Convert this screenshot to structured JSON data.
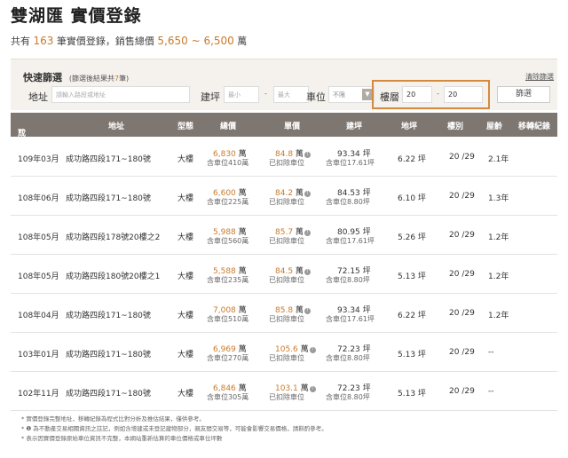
{
  "header": {
    "title": "雙湖匯 實價登錄",
    "summary_prefix": "共有",
    "count": "163",
    "summary_mid": "筆實價登錄，銷售總價",
    "price_range": "5,650 ~ 6,500",
    "summary_suffix": "萬"
  },
  "filter": {
    "title": "快速篩選",
    "subtitle_prefix": "(篩選後結果共",
    "result_count": "7",
    "subtitle_suffix": "筆)",
    "clear_label": "清除篩選",
    "address_label": "地址",
    "address_placeholder": "請輸入路段或地址",
    "area_label": "建坪",
    "area_min_placeholder": "最小",
    "area_max_placeholder": "最大",
    "parking_label": "車位",
    "parking_value": "不限",
    "floor_label": "樓層",
    "floor_min": "20",
    "floor_max": "20",
    "dash": "-",
    "search_label": "篩選"
  },
  "table": {
    "headers": [
      "成交年月",
      "地址",
      "型態",
      "總價",
      "單價",
      "建坪",
      "地坪",
      "樓別",
      "屋齡",
      "移轉紀錄"
    ],
    "sort_arrow": "▾",
    "wan": "萬",
    "ping": "坪",
    "info_glyph": "!",
    "rows": [
      {
        "date": "109年03月",
        "address": "成功路四段171~180號",
        "type": "大樓",
        "total": "6,830",
        "total_sub": "含車位410萬",
        "unit": "84.8",
        "unit_sub": "已扣除車位",
        "area": "93.34",
        "area_sub": "含車位17.61坪",
        "land": "6.22",
        "floor": "20 /29",
        "age": "2.1年"
      },
      {
        "date": "108年06月",
        "address": "成功路四段171~180號",
        "type": "大樓",
        "total": "6,600",
        "total_sub": "含車位225萬",
        "unit": "84.2",
        "unit_sub": "已扣除車位",
        "area": "84.53",
        "area_sub": "含車位8.80坪",
        "land": "6.10",
        "floor": "20 /29",
        "age": "1.3年"
      },
      {
        "date": "108年05月",
        "address": "成功路四段178號20樓之2",
        "type": "大樓",
        "total": "5,988",
        "total_sub": "含車位560萬",
        "unit": "85.7",
        "unit_sub": "已扣除車位",
        "area": "80.95",
        "area_sub": "含車位17.61坪",
        "land": "5.26",
        "floor": "20 /29",
        "age": "1.2年"
      },
      {
        "date": "108年05月",
        "address": "成功路四段180號20樓之1",
        "type": "大樓",
        "total": "5,588",
        "total_sub": "含車位235萬",
        "unit": "84.5",
        "unit_sub": "已扣除車位",
        "area": "72.15",
        "area_sub": "含車位8.80坪",
        "land": "5.13",
        "floor": "20 /29",
        "age": "1.2年"
      },
      {
        "date": "108年04月",
        "address": "成功路四段171~180號",
        "type": "大樓",
        "total": "7,008",
        "total_sub": "含車位510萬",
        "unit": "85.8",
        "unit_sub": "已扣除車位",
        "area": "93.34",
        "area_sub": "含車位17.61坪",
        "land": "6.22",
        "floor": "20 /29",
        "age": "1.2年"
      },
      {
        "date": "103年01月",
        "address": "成功路四段171~180號",
        "type": "大樓",
        "total": "6,969",
        "total_sub": "含車位270萬",
        "unit": "105.6",
        "unit_sub": "已扣除車位",
        "area": "72.23",
        "area_sub": "含車位8.80坪",
        "land": "5.13",
        "floor": "20 /29",
        "age": "--"
      },
      {
        "date": "102年11月",
        "address": "成功路四段171~180號",
        "type": "大樓",
        "total": "6,846",
        "total_sub": "含車位305萬",
        "unit": "103.1",
        "unit_sub": "已扣除車位",
        "area": "72.23",
        "area_sub": "含車位8.80坪",
        "land": "5.13",
        "floor": "20 /29",
        "age": "--"
      }
    ]
  },
  "notes": [
    "* 實價登錄完整地址，移轉紀錄為程式比對分析及推估結果，僅供參考。",
    "* ❶ 為不動產交易相關資訊之註記，例如含增建或未登記建物部分，親友間交易等，可能會影響交易價格，請斟酌參考。",
    "* 表示因實價登錄原始車位資訊不完整，本網站重新估算的車位價格或車位坪數"
  ],
  "colors": {
    "accent": "#c97a2b",
    "header_bg": "#7e7671",
    "highlight_border": "#d58a3e"
  }
}
